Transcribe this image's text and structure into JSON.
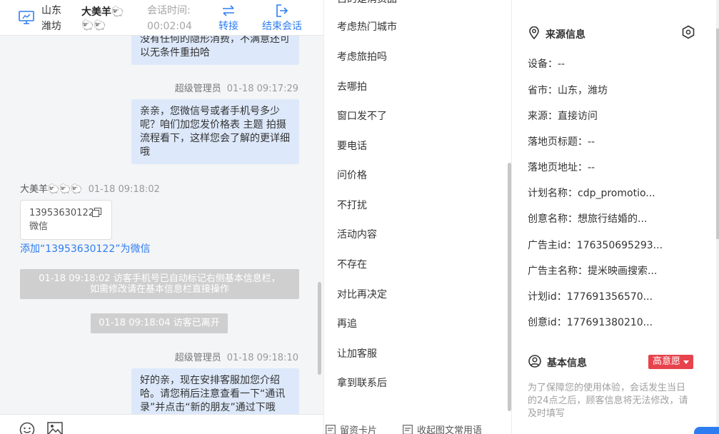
{
  "header": {
    "province": "山东",
    "city": "潍坊",
    "visitor_name": "大美羊🐑",
    "visitor_name_tail": "🐑🐑",
    "session_label": "会话时间:",
    "session_time": "00:02:04",
    "transfer_label": "转接",
    "end_label": "结束会话"
  },
  "messages": {
    "msg1_text": "没有任何的隐形消费，不满意还可以无条件重拍哈",
    "msg2_sender": "超级管理员",
    "msg2_time": "01-18 09:17:29",
    "msg2_text": "亲亲，您微信号或者手机号多少呢？咱们加您发价格表 主题 拍摄流程看下，这样您会了解的更详细哦",
    "msg3_sender": "大美羊🐑🐑🐑",
    "msg3_time": "01-18 09:18:02",
    "card_number": "13953630122",
    "card_type": "微信",
    "add_link": "添加“13953630122”为微信",
    "sys1_line1": "01-18 09:18:02 访客手机号已自动标记右侧基本信息栏，",
    "sys1_line2": "如需修改请在基本信息栏直接操作",
    "sys2": "01-18 09:18:04 访客已离开",
    "msg4_sender": "超级管理员",
    "msg4_time": "01-18 09:18:10",
    "msg4_text": "好的亲，现在安排客服加您介绍哈。请您稍后注意查看一下“通讯录”并点击“新的朋友”通过下哦"
  },
  "quick_replies": [
    "自的是消费品",
    "考虑热门城市",
    "考虑旅拍吗",
    "去哪拍",
    "窗口发不了",
    "要电话",
    "问价格",
    "不打扰",
    "活动内容",
    "不存在",
    "对比再决定",
    "再追",
    "让加客服",
    "拿到联系后"
  ],
  "quick_footer": {
    "card_label": "留资卡片",
    "template_label": "收起图文常用语"
  },
  "info": {
    "source_title": "来源信息",
    "rows": [
      {
        "k": "设备：",
        "v": "--"
      },
      {
        "k": "省市：",
        "v": "山东，潍坊"
      },
      {
        "k": "来源：",
        "v": "直接访问"
      },
      {
        "k": "落地页标题：",
        "v": "--"
      },
      {
        "k": "落地页地址：",
        "v": "--"
      },
      {
        "k": "计划名称：",
        "v": "cdp_promotio..."
      },
      {
        "k": "创意名称：",
        "v": "想旅行结婚的..."
      },
      {
        "k": "广告主id：",
        "v": "176350695293..."
      },
      {
        "k": "广告主名称：",
        "v": "提米映画搜索..."
      },
      {
        "k": "计划id：",
        "v": "177691356570..."
      },
      {
        "k": "创意id：",
        "v": "177691380210..."
      }
    ],
    "basic_title": "基本信息",
    "intent_label": "高意愿",
    "hint": "为了保障您的使用体验，会话发生当日的24点之后，顾客信息将无法修改，请及时填写"
  },
  "colors": {
    "accent": "#2e7df0",
    "bubble": "#dde9fb",
    "intent": "#e7434c",
    "system_note": "#cfcfcf"
  },
  "icons": {
    "monitor": "monitor-icon",
    "transfer": "transfer-arrows-icon",
    "end": "exit-icon",
    "copy": "copy-icon",
    "location": "location-pin-icon",
    "settings": "hexagon-settings-icon",
    "user": "user-circle-icon",
    "emoji": "emoji-icon",
    "image": "image-icon"
  }
}
